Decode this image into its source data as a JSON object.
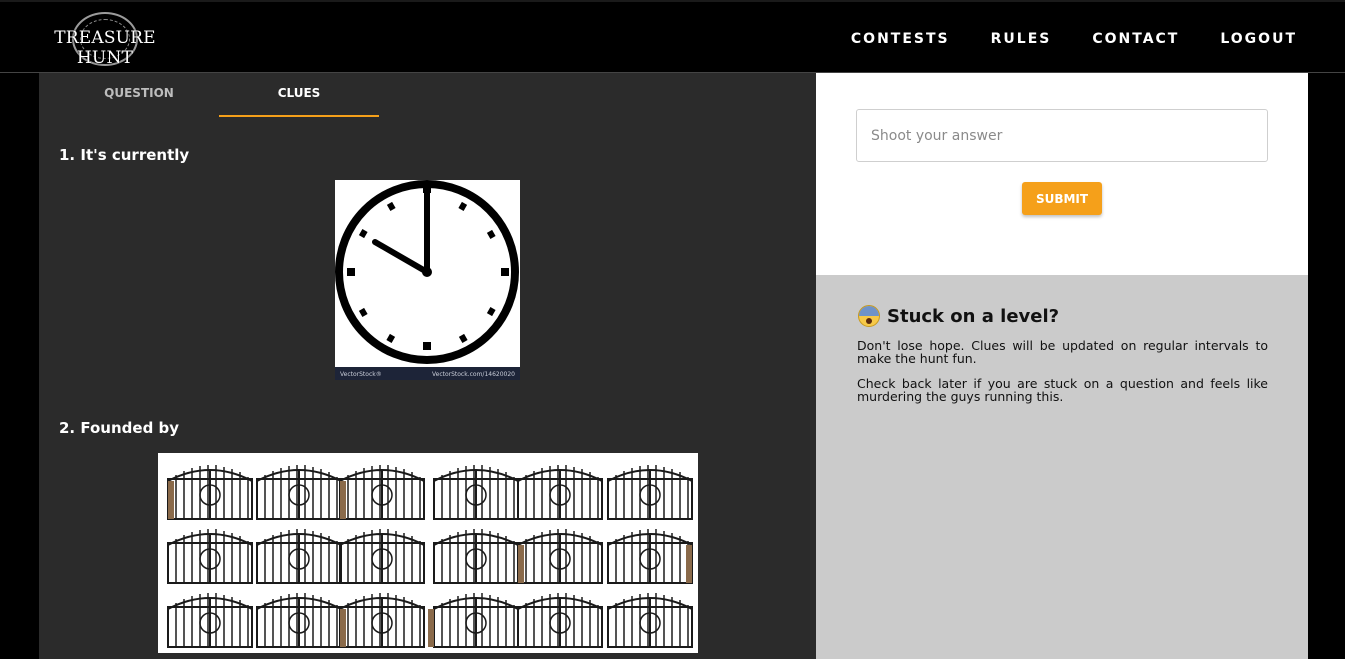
{
  "brand": {
    "logo_text": "TREASURE HUNT"
  },
  "nav": {
    "items": [
      {
        "label": "CONTESTS"
      },
      {
        "label": "RULES"
      },
      {
        "label": "CONTACT"
      },
      {
        "label": "LOGOUT"
      }
    ]
  },
  "tabs": [
    {
      "label": "QUESTION",
      "active": false
    },
    {
      "label": "CLUES",
      "active": true
    }
  ],
  "clues": [
    {
      "title": "1. It's currently",
      "image": "clock-image",
      "watermark_left": "VectorStock®",
      "watermark_right": "VectorStock.com/14620020"
    },
    {
      "title": "2. Founded by",
      "image": "iron-gates-image"
    }
  ],
  "answer": {
    "placeholder": "Shoot your answer",
    "value": "",
    "submit_label": "SUBMIT"
  },
  "help": {
    "icon": "fearful-face-emoji",
    "title": "Stuck on a level?",
    "paragraphs": [
      "Don't lose hope. Clues will be updated on regular intervals to make the hunt fun.",
      "Check back later if you are stuck on a question and feels like murdering the guys running this."
    ]
  },
  "colors": {
    "accent": "#f5a01a",
    "nav_bg": "#000000",
    "panel_dark": "#2b2b2b",
    "panel_grey": "#cbcbcb"
  }
}
